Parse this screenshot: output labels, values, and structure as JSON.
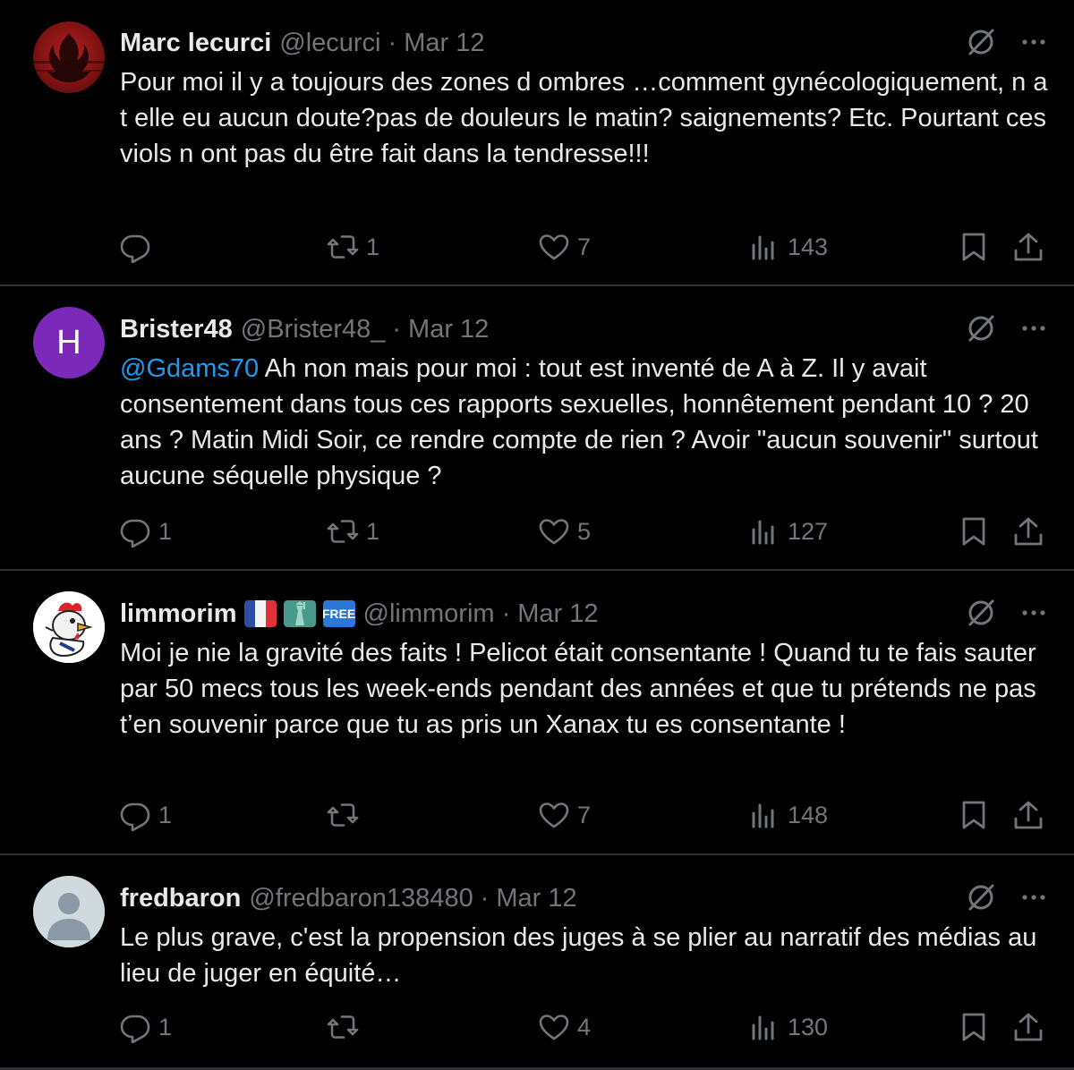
{
  "tweets": [
    {
      "name": "Marc lecurci",
      "handle": "@lecurci",
      "dot": "·",
      "date": "Mar 12",
      "text": "Pour moi il y a toujours des zones d ombres …comment gynécologiquement, n a t elle eu aucun doute?pas de douleurs le matin? saignements? Etc. Pourtant ces viols n ont pas du être fait dans la tendresse!!!",
      "replies": "",
      "retweets": "1",
      "likes": "7",
      "views": "143"
    },
    {
      "name": "Brister48",
      "handle": "@Brister48_",
      "dot": "·",
      "date": "Mar 12",
      "avatar_letter": "H",
      "mention": "@Gdams70",
      "text": " Ah non mais pour moi : tout est inventé de A à Z. Il y avait consentement dans tous ces rapports sexuelles, honnêtement pendant 10 ? 20 ans ? Matin Midi Soir, ce rendre compte de rien ? Avoir \"aucun souvenir\" surtout aucune séquelle physique ?",
      "replies": "1",
      "retweets": "1",
      "likes": "5",
      "views": "127"
    },
    {
      "name": "limmorim",
      "handle": "@limmorim",
      "dot": "·",
      "date": "Mar 12",
      "badge_free": "FREE",
      "text": "Moi je nie la gravité des faits ! Pelicot était consentante ! Quand tu te fais sauter par 50 mecs tous les week-ends pendant des années et que tu prétends ne pas t’en souvenir parce que tu as pris un Xanax tu es consentante !",
      "replies": "1",
      "retweets": "",
      "likes": "7",
      "views": "148"
    },
    {
      "name": "fredbaron",
      "handle": "@fredbaron138480",
      "dot": "·",
      "date": "Mar 12",
      "text": "Le plus grave, c'est la propension des juges à se plier au narratif des médias au lieu de juger en équité…",
      "replies": "1",
      "retweets": "",
      "likes": "4",
      "views": "130"
    }
  ],
  "icons": {
    "reply": "reply-icon",
    "retweet": "retweet-icon",
    "like": "heart-icon",
    "views": "views-icon",
    "bookmark": "bookmark-icon",
    "share": "share-icon",
    "grok": "grok-icon",
    "more": "more-icon"
  },
  "colors": {
    "background": "#000000",
    "text": "#e7e9ea",
    "secondary": "#71767b",
    "divider": "#2f3336",
    "link": "#1d9bf0"
  }
}
